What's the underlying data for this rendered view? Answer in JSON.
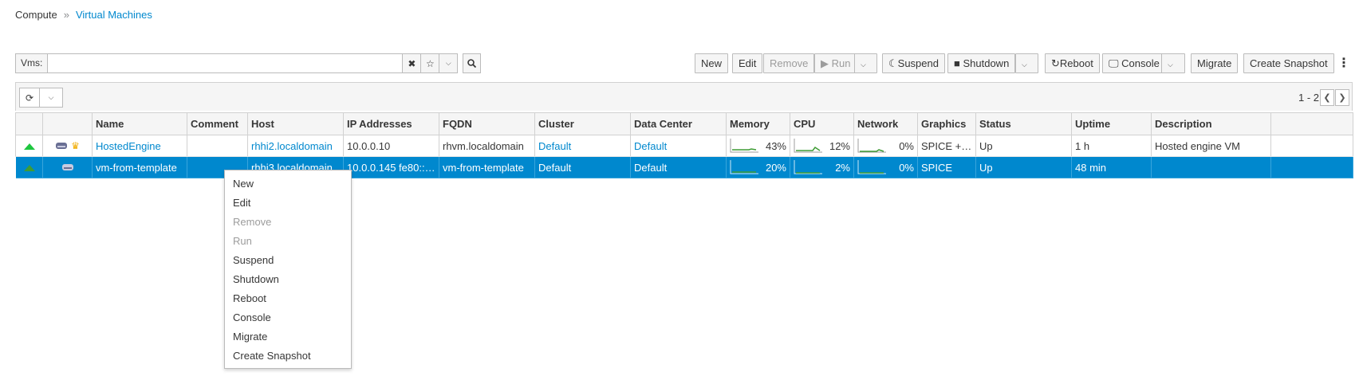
{
  "breadcrumb": {
    "parent": "Compute",
    "separator": "»",
    "current": "Virtual Machines"
  },
  "search": {
    "label": "Vms:",
    "value": "",
    "placeholder": ""
  },
  "toolbar": {
    "new": "New",
    "edit": "Edit",
    "remove": "Remove",
    "run": "Run",
    "suspend": "Suspend",
    "shutdown": "Shutdown",
    "reboot": "Reboot",
    "console": "Console",
    "migrate": "Migrate",
    "create_snapshot": "Create Snapshot"
  },
  "pager": {
    "range": "1 - 2"
  },
  "columns": [
    "",
    "",
    "Name",
    "Comment",
    "Host",
    "IP Addresses",
    "FQDN",
    "Cluster",
    "Data Center",
    "Memory",
    "CPU",
    "Network",
    "Graphics",
    "Status",
    "Uptime",
    "Description",
    ""
  ],
  "rows": [
    {
      "name": "HostedEngine",
      "comment": "",
      "host": "rhhi2.localdomain",
      "ip": "10.0.0.10",
      "fqdn": "rhvm.localdomain",
      "cluster": "Default",
      "datacenter": "Default",
      "memory": "43%",
      "cpu": "12%",
      "network": "0%",
      "graphics": "SPICE + V...",
      "status": "Up",
      "uptime": "1 h",
      "description": "Hosted engine VM"
    },
    {
      "name": "vm-from-template",
      "comment": "",
      "host": "rhhi3.localdomain",
      "ip": "10.0.0.145 fe80::2...",
      "fqdn": "vm-from-template",
      "cluster": "Default",
      "datacenter": "Default",
      "memory": "20%",
      "cpu": "2%",
      "network": "0%",
      "graphics": "SPICE",
      "status": "Up",
      "uptime": "48 min",
      "description": ""
    }
  ],
  "context_menu": {
    "items": [
      "New",
      "Edit",
      "Remove",
      "Run",
      "Suspend",
      "Shutdown",
      "Reboot",
      "Console",
      "Migrate",
      "Create Snapshot"
    ]
  },
  "colors": {
    "accent": "#0088ce",
    "selected_row": "#0088ce",
    "status_up": "#3f9c35"
  }
}
